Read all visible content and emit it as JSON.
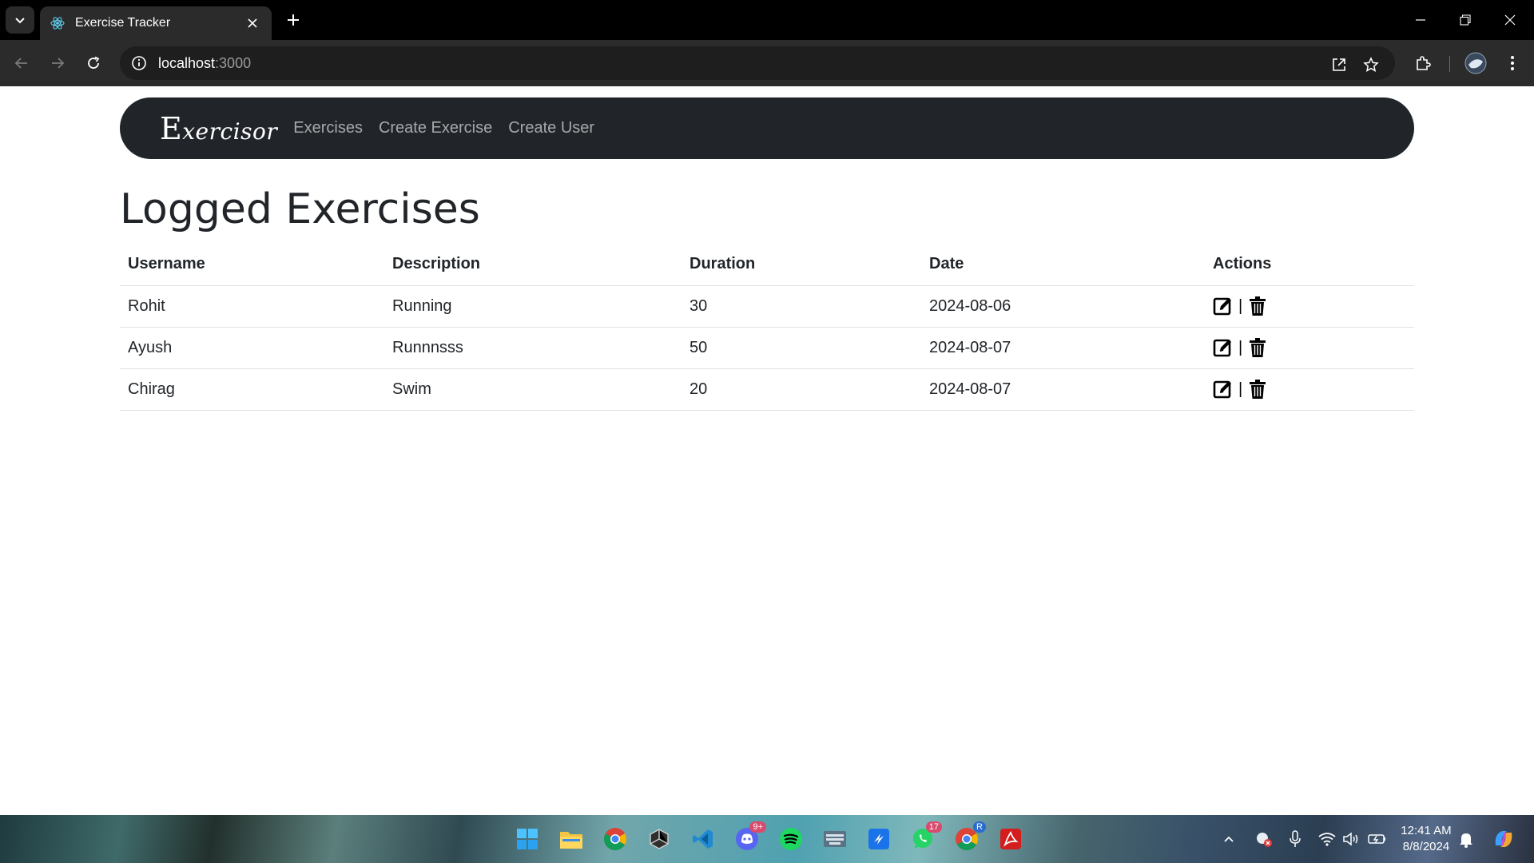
{
  "browser": {
    "tab_title": "Exercise Tracker",
    "url_host": "localhost",
    "url_port": ":3000"
  },
  "navbar": {
    "brand_first": "E",
    "brand_rest": "xercisor",
    "links": [
      "Exercises",
      "Create Exercise",
      "Create User"
    ]
  },
  "page": {
    "title": "Logged Exercises"
  },
  "table": {
    "headers": [
      "Username",
      "Description",
      "Duration",
      "Date",
      "Actions"
    ],
    "rows": [
      {
        "username": "Rohit",
        "description": "Running",
        "duration": "30",
        "date": "2024-08-06"
      },
      {
        "username": "Ayush",
        "description": "Runnnsss",
        "duration": "50",
        "date": "2024-08-07"
      },
      {
        "username": "Chirag",
        "description": "Swim",
        "duration": "20",
        "date": "2024-08-07"
      }
    ],
    "action_separator": "|"
  },
  "taskbar": {
    "badges": {
      "discord": "9+",
      "whatsapp": "17",
      "chrome_profile": "R"
    },
    "time": "12:41 AM",
    "date": "8/8/2024"
  },
  "colors": {
    "navbar_bg": "#212529",
    "chrome_dark": "#2b2b2b"
  }
}
